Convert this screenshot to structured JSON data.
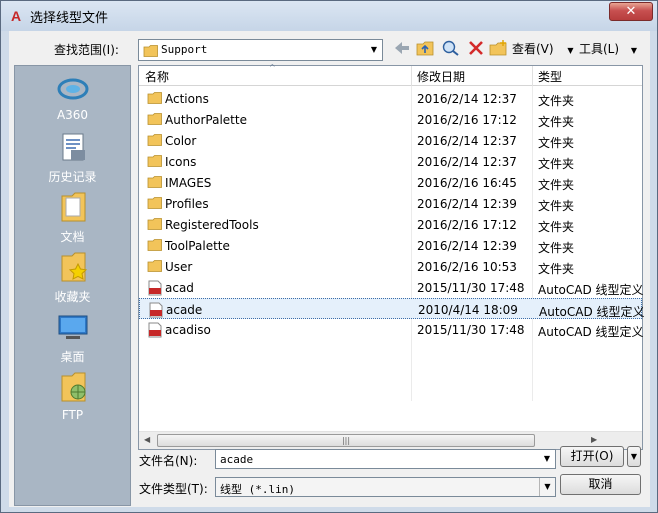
{
  "title": "选择线型文件",
  "close_label": "✕",
  "lookin": {
    "label": "查找范围(I):",
    "value": "Support"
  },
  "toolbar": {
    "view_label": "查看(V)",
    "tools_label": "工具(L)"
  },
  "places": [
    {
      "label": "A360",
      "icon": "a360-icon"
    },
    {
      "label": "历史记录",
      "icon": "history-icon"
    },
    {
      "label": "文档",
      "icon": "documents-icon"
    },
    {
      "label": "收藏夹",
      "icon": "favorites-icon"
    },
    {
      "label": "桌面",
      "icon": "desktop-icon"
    },
    {
      "label": "FTP",
      "icon": "ftp-icon"
    }
  ],
  "columns": {
    "name": "名称",
    "date": "修改日期",
    "type": "类型"
  },
  "files": [
    {
      "name": "Actions",
      "date": "2016/2/14 12:37",
      "type": "文件夹",
      "kind": "folder"
    },
    {
      "name": "AuthorPalette",
      "date": "2016/2/16 17:12",
      "type": "文件夹",
      "kind": "folder"
    },
    {
      "name": "Color",
      "date": "2016/2/14 12:37",
      "type": "文件夹",
      "kind": "folder"
    },
    {
      "name": "Icons",
      "date": "2016/2/14 12:37",
      "type": "文件夹",
      "kind": "folder"
    },
    {
      "name": "IMAGES",
      "date": "2016/2/16 16:45",
      "type": "文件夹",
      "kind": "folder"
    },
    {
      "name": "Profiles",
      "date": "2016/2/14 12:39",
      "type": "文件夹",
      "kind": "folder"
    },
    {
      "name": "RegisteredTools",
      "date": "2016/2/16 17:12",
      "type": "文件夹",
      "kind": "folder"
    },
    {
      "name": "ToolPalette",
      "date": "2016/2/14 12:39",
      "type": "文件夹",
      "kind": "folder"
    },
    {
      "name": "User",
      "date": "2016/2/16 10:53",
      "type": "文件夹",
      "kind": "folder"
    },
    {
      "name": "acad",
      "date": "2015/11/30 17:48",
      "type": "AutoCAD 线型定义",
      "kind": "lin"
    },
    {
      "name": "acade",
      "date": "2010/4/14 18:09",
      "type": "AutoCAD 线型定义",
      "kind": "lin",
      "selected": true
    },
    {
      "name": "acadiso",
      "date": "2015/11/30 17:48",
      "type": "AutoCAD 线型定义",
      "kind": "lin"
    }
  ],
  "filename": {
    "label": "文件名(N):",
    "value": "acade"
  },
  "filetype": {
    "label": "文件类型(T):",
    "value": "线型 (*.lin)"
  },
  "buttons": {
    "open": "打开(O)",
    "cancel": "取消"
  },
  "colors": {
    "places_bg": "#a9b6c4",
    "selection": "#e5f0fb",
    "folder": "#f2c45a"
  }
}
